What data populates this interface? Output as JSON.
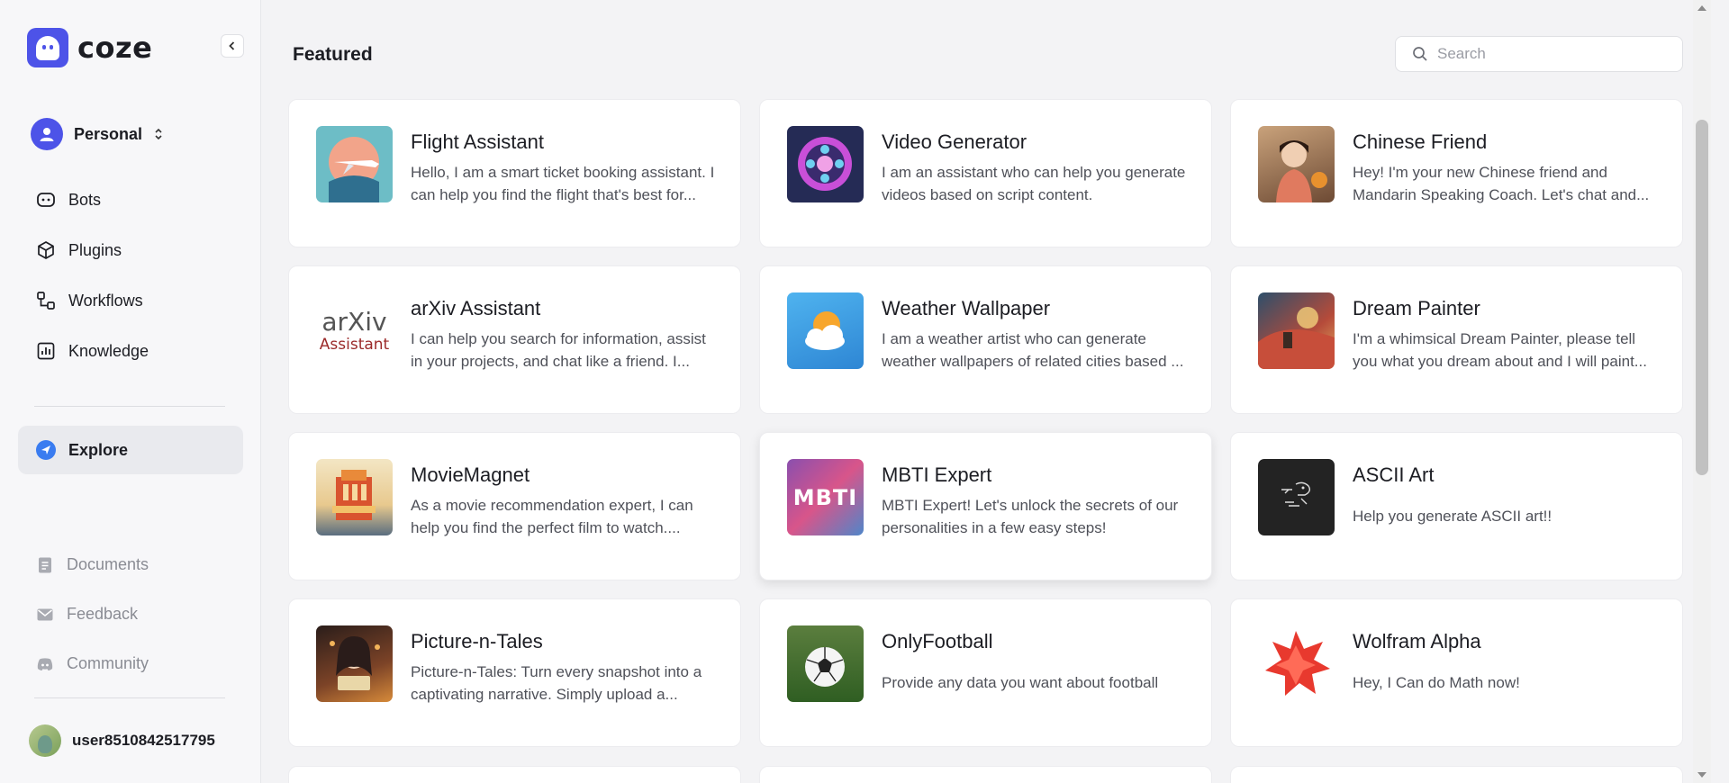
{
  "app": {
    "name": "coze"
  },
  "sidebar": {
    "workspace": "Personal",
    "nav": [
      {
        "label": "Bots",
        "icon": "bot-icon"
      },
      {
        "label": "Plugins",
        "icon": "cube-icon"
      },
      {
        "label": "Workflows",
        "icon": "workflow-icon"
      },
      {
        "label": "Knowledge",
        "icon": "chart-icon"
      }
    ],
    "explore": "Explore",
    "footer": [
      {
        "label": "Documents",
        "icon": "document-icon"
      },
      {
        "label": "Feedback",
        "icon": "mail-icon"
      },
      {
        "label": "Community",
        "icon": "discord-icon"
      }
    ],
    "user": "user8510842517795"
  },
  "main": {
    "title": "Featured",
    "search_placeholder": "Search",
    "cards": [
      {
        "name": "Flight Assistant",
        "desc": "Hello, I am a smart ticket booking assistant. I can help you find the flight that's best for...",
        "thumb": "flight"
      },
      {
        "name": "Video Generator",
        "desc": "I am an assistant who can help you generate videos based on script content.",
        "thumb": "video"
      },
      {
        "name": "Chinese Friend",
        "desc": "Hey! I'm your new Chinese friend and Mandarin Speaking Coach. Let's chat and...",
        "thumb": "chinese"
      },
      {
        "name": "arXiv Assistant",
        "desc": "I can help you search for information, assist in your projects, and chat like a friend. I...",
        "thumb": "arxiv"
      },
      {
        "name": "Weather Wallpaper",
        "desc": "I am a weather artist who can generate weather wallpapers of related cities based ...",
        "thumb": "weather"
      },
      {
        "name": "Dream Painter",
        "desc": "I'm a whimsical Dream Painter, please tell you what you dream about and I will paint...",
        "thumb": "dream"
      },
      {
        "name": "MovieMagnet",
        "desc": "As a movie recommendation expert, I can help you find the perfect film to watch....",
        "thumb": "movie"
      },
      {
        "name": "MBTI Expert",
        "desc": "MBTI Expert! Let's unlock the secrets of our personalities in a few easy steps!",
        "thumb": "mbti"
      },
      {
        "name": "ASCII Art",
        "desc": "Help you generate ASCII art!!",
        "thumb": "ascii"
      },
      {
        "name": "Picture-n-Tales",
        "desc": "Picture-n-Tales: Turn every snapshot into a captivating narrative. Simply upload a...",
        "thumb": "picture"
      },
      {
        "name": "OnlyFootball",
        "desc": "Provide any data you want about football",
        "thumb": "football"
      },
      {
        "name": "Wolfram Alpha",
        "desc": "Hey, I Can do Math now!",
        "thumb": "wolfram"
      }
    ],
    "arxiv_logo": {
      "line1": "arXiv",
      "line2": "Assistant"
    },
    "mbti_logo": "MBTI"
  },
  "colors": {
    "accent": "#4d53e8",
    "explore_icon": "#3a7cf0",
    "background": "#f3f3f5"
  }
}
